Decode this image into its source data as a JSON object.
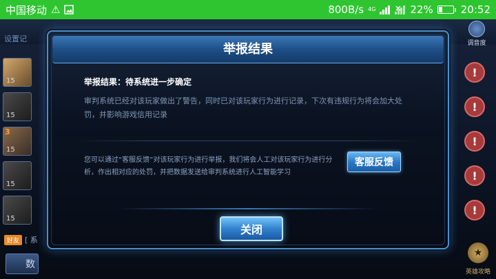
{
  "status_bar": {
    "carrier": "中国移动",
    "speed": "800B/s",
    "network_label": "4G",
    "battery_percent": "22%",
    "battery_level": 0.22,
    "time": "20:52"
  },
  "background": {
    "top_left_label": "设置记",
    "top_right_label": "调音度",
    "avatars": [
      {
        "level": "15"
      },
      {
        "level": "15"
      },
      {
        "level": "15",
        "badge": "3"
      },
      {
        "level": "15"
      },
      {
        "level": "15"
      }
    ],
    "bottom_tag": "好友",
    "bottom_text": "[ 系",
    "bottom_button": "数",
    "guide_label": "英雄攻略"
  },
  "dialog": {
    "title": "举报结果",
    "result_line": "举报结果：待系统进一步确定",
    "result_desc": "审判系统已经对该玩家做出了警告，同时已对该玩家行为进行记录，下次有违规行为将会加大处罚，并影响游戏信用记录",
    "feedback_text": "您可以通过“客服反馈”对该玩家行为进行举报，我们将会人工对该玩家行为进行分析，作出相对应的处罚，并把数据发送给审判系统进行人工智能学习",
    "feedback_button": "客服反馈",
    "close_button": "关闭"
  }
}
